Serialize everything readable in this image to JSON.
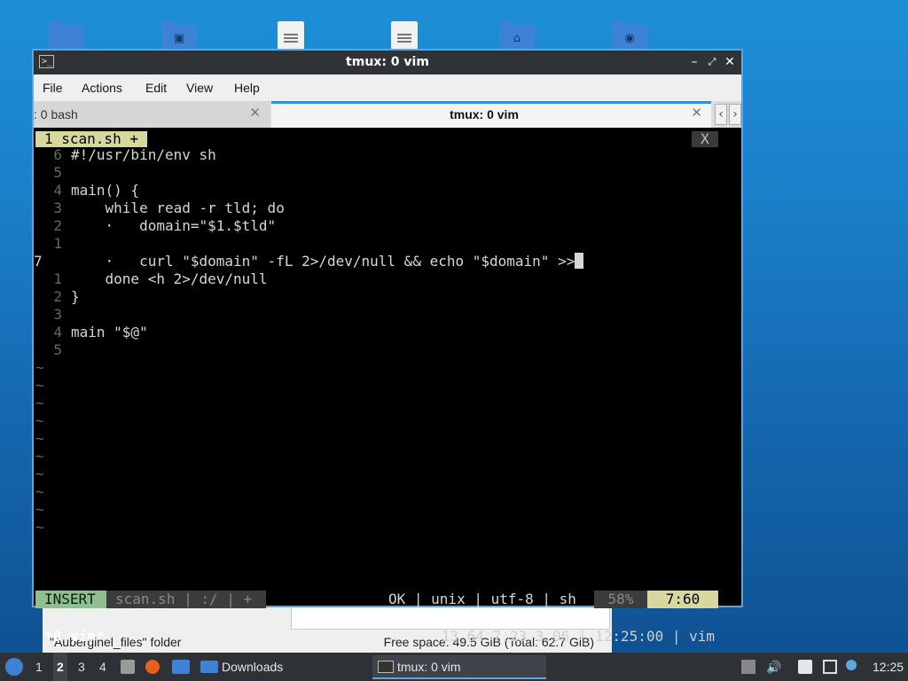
{
  "desktop": {
    "icons": [
      {
        "name": "folder-icon",
        "glyph": ""
      },
      {
        "name": "pictures-folder-icon",
        "glyph": "▣"
      },
      {
        "name": "document-icon",
        "glyph": ""
      },
      {
        "name": "document-icon",
        "glyph": ""
      },
      {
        "name": "home-folder-icon",
        "glyph": "⌂"
      },
      {
        "name": "network-folder-icon",
        "glyph": "◉"
      }
    ]
  },
  "file_manager": {
    "status_left": "\"Auberginel_files\" folder",
    "status_right": "Free space: 49.5 GiB (Total: 62.7 GiB)"
  },
  "window": {
    "title": "tmux: 0 vim",
    "menu": [
      "File",
      "Actions",
      "Edit",
      "View",
      "Help"
    ],
    "tabs": [
      {
        "label": ": 0 bash",
        "active": false
      },
      {
        "label": "tmux: 0 vim",
        "active": true
      }
    ]
  },
  "vim": {
    "tab_label": "1  scan.sh  +",
    "close_label": "X",
    "lines": [
      {
        "num": "6",
        "text": "#!/usr/bin/env sh",
        "current": false
      },
      {
        "num": "5",
        "text": "",
        "current": false
      },
      {
        "num": "4",
        "text": "main() {",
        "current": false
      },
      {
        "num": "3",
        "text": "    while read -r tld; do",
        "current": false
      },
      {
        "num": "2",
        "text": "    ·   domain=\"$1.$tld\"",
        "current": false
      },
      {
        "num": "1",
        "text": "",
        "current": false
      },
      {
        "num": "7",
        "text": "    ·   curl \"$domain\" -fL 2>/dev/null && echo \"$domain\" >>",
        "current": true
      },
      {
        "num": "1",
        "text": "    done <h 2>/dev/null",
        "current": false
      },
      {
        "num": "2",
        "text": "}",
        "current": false
      },
      {
        "num": "3",
        "text": "",
        "current": false
      },
      {
        "num": "4",
        "text": "main \"$@\"",
        "current": false
      },
      {
        "num": "5",
        "text": "",
        "current": false
      }
    ],
    "tilde": "~",
    "tilde_count": 10,
    "status": {
      "mode": "INSERT",
      "file": "scan.sh  |  :/  |  +",
      "right": "OK  |  unix  |  utf-8  |  sh",
      "percent": "58%",
      "position": "7:60"
    }
  },
  "tmux": {
    "left": "*0 vim*",
    "right": "13.64 7.23 3.06  |  12:25:00  |  vim"
  },
  "taskbar": {
    "workspaces": [
      "1",
      "2",
      "3",
      "4"
    ],
    "active_workspace": "2",
    "downloads_label": "Downloads",
    "active_task": "tmux: 0 vim",
    "clock": "12:25"
  },
  "colors": {
    "accent": "#5ea6e0",
    "vim_tab": "#d7d7a0",
    "insert_mode": "#8fbf8f"
  }
}
